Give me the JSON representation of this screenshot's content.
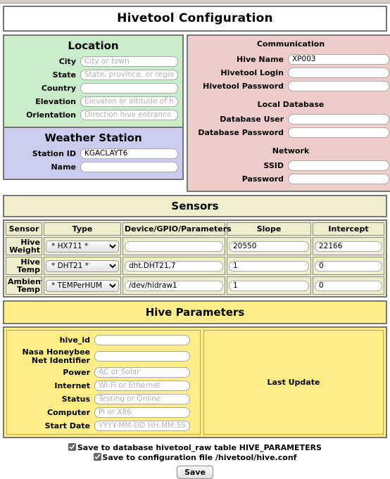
{
  "header": {
    "title": "Hivetool Configuration"
  },
  "location": {
    "title": "Location",
    "fields": [
      {
        "label": "City",
        "value": "",
        "placeholder": "City or town"
      },
      {
        "label": "State",
        "value": "",
        "placeholder": "State, province, or region"
      },
      {
        "label": "Country",
        "value": "",
        "placeholder": ""
      },
      {
        "label": "Elevation",
        "value": "",
        "placeholder": "Elevaton or altitude of hive"
      },
      {
        "label": "Orientation",
        "value": "",
        "placeholder": "Direction hive entrance faces"
      }
    ]
  },
  "weather_station": {
    "title": "Weather Station",
    "fields": [
      {
        "label": "Station ID",
        "value": "KGACLAYT6",
        "placeholder": ""
      },
      {
        "label": "Name",
        "value": "",
        "placeholder": ""
      }
    ]
  },
  "communication": {
    "title": "Communication",
    "fields": [
      {
        "label": "Hive Name",
        "value": "XP003",
        "placeholder": ""
      },
      {
        "label": "Hivetool Login",
        "value": "",
        "placeholder": ""
      },
      {
        "label": "Hivetool Password",
        "value": "",
        "placeholder": ""
      }
    ],
    "local_database": {
      "title": "Local Database",
      "fields": [
        {
          "label": "Database User",
          "value": "",
          "placeholder": ""
        },
        {
          "label": "Database Password",
          "value": "",
          "placeholder": ""
        }
      ]
    },
    "network": {
      "title": "Network",
      "fields": [
        {
          "label": "SSID",
          "value": "",
          "placeholder": ""
        },
        {
          "label": "Password",
          "value": "",
          "placeholder": ""
        }
      ]
    }
  },
  "sensors": {
    "title": "Sensors",
    "columns": [
      "Sensor",
      "Type",
      "Device/GPIO/Parameters",
      "Slope",
      "Intercept"
    ],
    "rows": [
      {
        "sensor": "Hive Weight",
        "type": "* HX711 *",
        "type_options": [
          "* HX711 *"
        ],
        "device": "",
        "device_placeholder": "",
        "slope": "20550",
        "intercept": "22166"
      },
      {
        "sensor": "Hive Temp",
        "type": "* DHT21 *",
        "type_options": [
          "* DHT21 *"
        ],
        "device": "dht.DHT21,7",
        "device_placeholder": "",
        "slope": "1",
        "intercept": "0"
      },
      {
        "sensor": "Ambient Temp",
        "type": "* TEMPerHUM *",
        "type_options": [
          "* TEMPerHUM *"
        ],
        "device": "/dev/hidraw1",
        "device_placeholder": "",
        "slope": "1",
        "intercept": "0"
      }
    ]
  },
  "hive_parameters": {
    "title": "Hive Parameters",
    "fields": [
      {
        "label": "hive_id",
        "value": "",
        "placeholder": ""
      },
      {
        "label": "Nasa Honeybee Net Identifier",
        "value": "",
        "placeholder": ""
      },
      {
        "label": "Power",
        "value": "",
        "placeholder": "AC or Solar"
      },
      {
        "label": "Internet",
        "value": "",
        "placeholder": "Wi-Fi or Ethernet"
      },
      {
        "label": "Status",
        "value": "",
        "placeholder": "Testing or Online"
      },
      {
        "label": "Computer",
        "value": "",
        "placeholder": "Pi or X86"
      },
      {
        "label": "Start Date",
        "value": "",
        "placeholder": "YYYY-MM-DD HH:MM:SS"
      }
    ],
    "last_update_label": "Last Update"
  },
  "footer": {
    "save_to_database_label": "Save to database hivetool_raw table HIVE_PARAMETERS",
    "save_to_database_checked": true,
    "save_to_config_label": "Save to configuration file /hivetool/hive.conf",
    "save_to_config_checked": true,
    "save_button_label": "Save"
  },
  "colors": {
    "location_bg": "#c9edc9",
    "weather_bg": "#ccccee",
    "communication_bg": "#eecccc",
    "sensors_bg": "#eeeecc",
    "hive_parameters_bg": "#ffee88"
  }
}
